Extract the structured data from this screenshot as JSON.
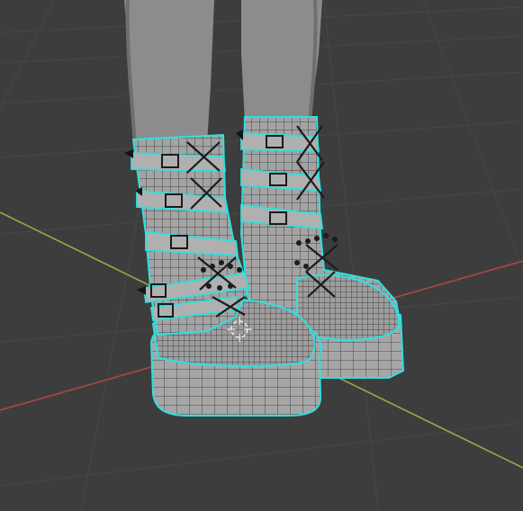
{
  "viewport": {
    "background": "#3d3d3d",
    "grid_color": "#4a4a4a",
    "x_axis_color": "#b04545",
    "y_axis_color": "#8ab040",
    "selection_outline_color": "#2fe0e0",
    "mesh_color": "#9a9a9a",
    "leg_color": "#8c8c8c"
  },
  "scene": {
    "mode": "edit-mode",
    "object": "platform-boots",
    "wireframe": true,
    "selection": "all"
  }
}
